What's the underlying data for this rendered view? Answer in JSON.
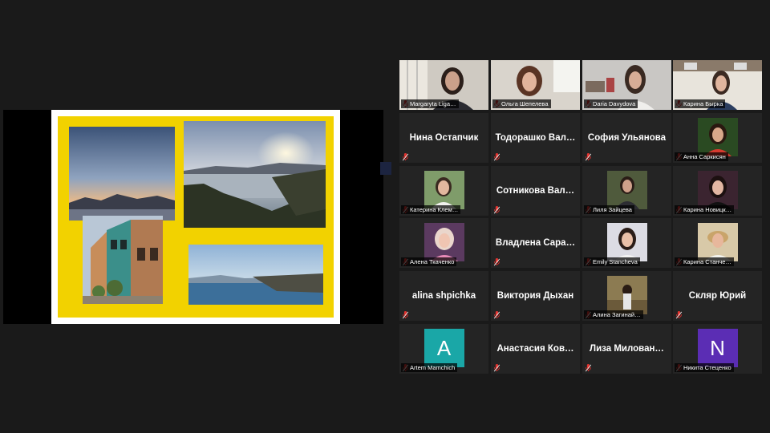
{
  "colors": {
    "background": "#1a1a1a",
    "tile": "#242424",
    "active_speaker_border": "#d8e85a",
    "slide_yellow": "#f2d200",
    "mic_muted": "#e0332f",
    "avatar_teal": "#1aa7a7",
    "avatar_purple": "#5b2db4"
  },
  "shared_screen": {
    "photos": [
      "sunset-mountains-photo",
      "bay-sunset-photo",
      "old-town-street-photo",
      "coastal-cliff-photo"
    ]
  },
  "participants": [
    {
      "label": "Margaryta Liga…",
      "display": "video",
      "muted": true
    },
    {
      "label": "Ольга Шепелева",
      "display": "video",
      "muted": true
    },
    {
      "label": "Daria Davydova",
      "display": "video",
      "muted": true,
      "active": true
    },
    {
      "label": "Карина Бырка",
      "display": "video",
      "muted": true
    },
    {
      "name": "Нина Остапчик",
      "display": "name",
      "muted": true
    },
    {
      "name": "Тодорашко Вал…",
      "display": "name",
      "muted": true
    },
    {
      "name": "София Ульянова",
      "display": "name",
      "muted": true
    },
    {
      "label": "Анна Саркисян",
      "display": "photo",
      "muted": true
    },
    {
      "label": "Катерина Клем…",
      "display": "photo",
      "muted": true
    },
    {
      "name": "Сотникова Вал…",
      "display": "name",
      "muted": true
    },
    {
      "label": "Лиля Зайцева",
      "display": "photo",
      "muted": true
    },
    {
      "label": "Карина Новицк…",
      "display": "photo",
      "muted": true
    },
    {
      "label": "Алена Ткаченко",
      "display": "photo",
      "muted": true
    },
    {
      "name": "Владлена Сара…",
      "display": "name",
      "muted": true
    },
    {
      "label": "Emily Stancheva",
      "display": "photo",
      "muted": true
    },
    {
      "label": "Карина Станче…",
      "display": "photo",
      "muted": true
    },
    {
      "name": "alina shpichka",
      "display": "name",
      "muted": true
    },
    {
      "name": "Виктория Дыхан",
      "display": "name",
      "muted": true
    },
    {
      "label": "Алина Загинай…",
      "display": "photo",
      "muted": true
    },
    {
      "name": "Скляр Юрий",
      "display": "name",
      "muted": true
    },
    {
      "label": "Artem Mamchich",
      "display": "letter",
      "letter": "A",
      "color": "#1aa7a7",
      "muted": true
    },
    {
      "name": "Анастасия Ков…",
      "display": "name",
      "muted": true
    },
    {
      "name": "Лиза Милован…",
      "display": "name",
      "muted": true
    },
    {
      "label": "Никита Стеценко",
      "display": "letter",
      "letter": "N",
      "color": "#5b2db4",
      "muted": true
    }
  ]
}
